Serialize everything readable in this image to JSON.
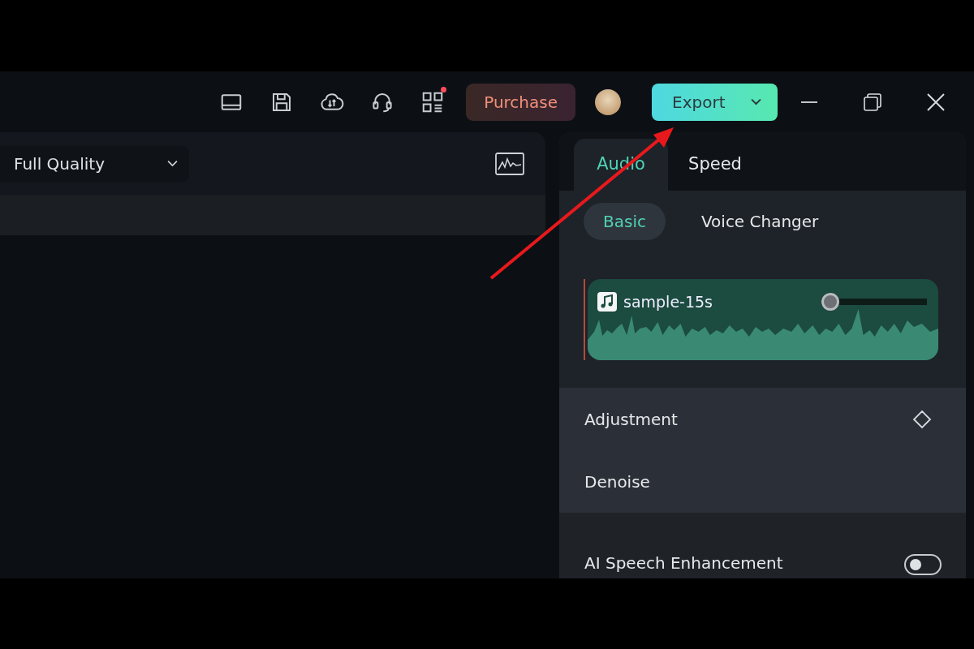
{
  "toolbar": {
    "purchase": "Purchase",
    "export": "Export",
    "notification_dot": true
  },
  "preview": {
    "quality": "Full Quality"
  },
  "tabs": [
    {
      "label": "Audio",
      "selected": true
    },
    {
      "label": "Speed",
      "selected": false
    }
  ],
  "subtabs": [
    {
      "label": "Basic",
      "selected": true
    },
    {
      "label": "Voice Changer",
      "selected": false
    }
  ],
  "clip": {
    "name": "sample-15s",
    "volume": {
      "level": 0.0
    }
  },
  "sections": [
    {
      "label": "Adjustment",
      "kind": "keyframe"
    },
    {
      "label": "Denoise",
      "kind": "plain"
    }
  ],
  "options": [
    {
      "label": "AI Speech Enhancement",
      "on": false
    }
  ]
}
